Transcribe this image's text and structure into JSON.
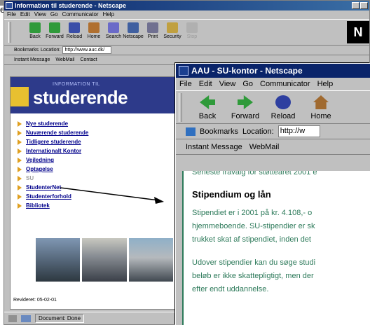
{
  "edge_letter": "e",
  "back_window": {
    "title": "Information til studerende - Netscape",
    "menu": [
      "File",
      "Edit",
      "View",
      "Go",
      "Communicator",
      "Help"
    ],
    "toolbar": [
      "Back",
      "Forward",
      "Reload",
      "Home",
      "Search",
      "Netscape",
      "Print",
      "Security",
      "Stop"
    ],
    "location_bar": {
      "bookmarks": "Bookmarks",
      "location_label": "Location:",
      "url": "http://www.auc.dk/"
    },
    "personal_bar": [
      "Instant Message",
      "WebMail",
      "Contact"
    ],
    "banner": {
      "small": "INFORMATION TIL",
      "big": "studerende"
    },
    "nav": [
      {
        "label": "Nye studerende",
        "dim": false
      },
      {
        "label": "Nuværende studerende",
        "dim": false
      },
      {
        "label": "Tidligere studerende",
        "dim": false
      },
      {
        "label": "Internationalt Kontor",
        "dim": false
      },
      {
        "label": "Vejledning",
        "dim": false
      },
      {
        "label": "Optagelse",
        "dim": false
      },
      {
        "label": "SU",
        "dim": true
      },
      {
        "label": "StudenterNet",
        "dim": false
      },
      {
        "label": "Studenterforhold",
        "dim": false
      },
      {
        "label": "Bibliotek",
        "dim": false
      }
    ],
    "revised": "Revideret: 05-02-01",
    "status": "Document: Done"
  },
  "front_window": {
    "title": "AAU - SU-kontor - Netscape",
    "menu": [
      "File",
      "Edit",
      "View",
      "Go",
      "Communicator",
      "Help"
    ],
    "toolbar": [
      "Back",
      "Forward",
      "Reload",
      "Home"
    ],
    "location_bar": {
      "bookmarks": "Bookmarks",
      "location_label": "Location:",
      "url": "http://w"
    },
    "personal_bar": [
      "Instant Message",
      "WebMail"
    ],
    "content": {
      "top_line": "Seneste fravalg for støtteåret 2001 e",
      "heading": "Stipendium og lån",
      "p1": [
        "Stipendiet er i 2001 på kr. 4.108,- o",
        "hjemmeboende. SU-stipendier er sk",
        "trukket skat af stipendiet, inden det"
      ],
      "p2": [
        "Udover stipendier kan du søge studi",
        "beløb er ikke skattepligtigt, men der",
        "efter endt uddannelse."
      ]
    }
  },
  "colors": {
    "title_bar": "#0a246a",
    "banner": "#2d3a8a",
    "nav_link": "#00008b",
    "accent_triangle": "#e0a020",
    "content_text": "#2d7a5a"
  }
}
